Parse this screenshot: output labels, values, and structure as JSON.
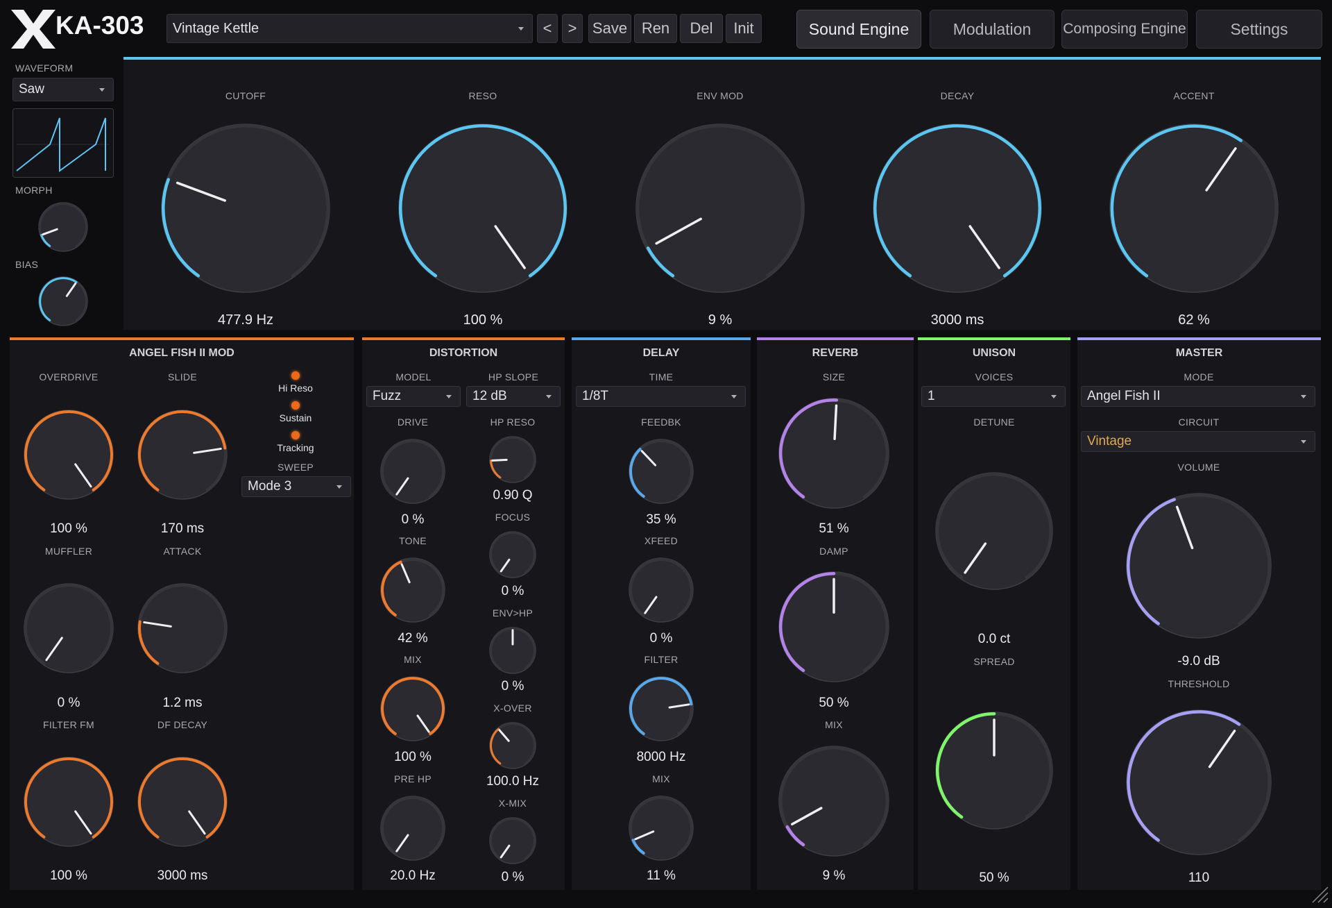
{
  "app": {
    "name": "KA-303",
    "logo_letter": "X"
  },
  "preset": {
    "name": "Vintage Kettle",
    "prev": "<",
    "next": ">",
    "save": "Save",
    "rename": "Ren",
    "delete": "Del",
    "init": "Init"
  },
  "tabs": [
    {
      "label": "Sound Engine",
      "active": true
    },
    {
      "label": "Modulation",
      "active": false
    },
    {
      "label": "Composing Engine",
      "active": false
    },
    {
      "label": "Settings",
      "active": false
    }
  ],
  "colors": {
    "blue": "#5cc6f2",
    "orange": "#ee7a2e",
    "purple": "#b483ea",
    "green": "#7ef56a",
    "lavender": "#a6a0f4",
    "delay_blue": "#5aa8ec",
    "vintage": "#e3a850"
  },
  "osc": {
    "waveform_label": "WAVEFORM",
    "waveform_value": "Saw",
    "morph_label": "MORPH",
    "morph_level": 0.12,
    "bias_label": "BIAS",
    "bias_level": 0.62
  },
  "main_knobs": [
    {
      "label": "CUTOFF",
      "value": "477.9 Hz",
      "level": 0.26
    },
    {
      "label": "RESO",
      "value": "100 %",
      "level": 1.0
    },
    {
      "label": "ENV MOD",
      "value": "9 %",
      "level": 0.09
    },
    {
      "label": "DECAY",
      "value": "3000 ms",
      "level": 1.0
    },
    {
      "label": "ACCENT",
      "value": "62 %",
      "level": 0.62
    }
  ],
  "angel": {
    "title": "ANGEL FISH II MOD",
    "knobs": [
      {
        "label": "OVERDRIVE",
        "value": "100 %",
        "level": 1.0
      },
      {
        "label": "SLIDE",
        "value": "170 ms",
        "level": 0.78
      },
      {
        "label": "MUFFLER",
        "value": "0 %",
        "level": 0.0
      },
      {
        "label": "ATTACK",
        "value": "1.2 ms",
        "level": 0.22
      },
      {
        "label": "FILTER FM",
        "value": "100 %",
        "level": 1.0
      },
      {
        "label": "DF DECAY",
        "value": "3000 ms",
        "level": 1.0
      }
    ],
    "toggles": [
      "Hi Reso",
      "Sustain",
      "Tracking"
    ],
    "sweep_label": "SWEEP",
    "sweep_value": "Mode 3"
  },
  "distortion": {
    "title": "DISTORTION",
    "model_label": "MODEL",
    "model_value": "Fuzz",
    "hpslope_label": "HP SLOPE",
    "hpslope_value": "12 dB",
    "left_knobs": [
      {
        "label": "DRIVE",
        "value": "0 %",
        "level": 0.0
      },
      {
        "label": "TONE",
        "value": "42 %",
        "level": 0.42
      },
      {
        "label": "MIX",
        "value": "100 %",
        "level": 1.0
      },
      {
        "label": "PRE HP",
        "value": "20.0 Hz",
        "level": 0.0
      }
    ],
    "right_knobs": [
      {
        "label": "HP RESO",
        "value": "0.90 Q",
        "level": 0.18
      },
      {
        "label": "FOCUS",
        "value": "0 %",
        "level": 0.0
      },
      {
        "label": "ENV>HP",
        "value": "0 %",
        "level": 0.5
      },
      {
        "label": "X-OVER",
        "value": "100.0 Hz",
        "level": 0.36
      },
      {
        "label": "X-MIX",
        "value": "0 %",
        "level": 0.0
      }
    ]
  },
  "delay": {
    "title": "DELAY",
    "time_label": "TIME",
    "time_value": "1/8T",
    "knobs": [
      {
        "label": "FEEDBK",
        "value": "35 %",
        "level": 0.35
      },
      {
        "label": "XFEED",
        "value": "0 %",
        "level": 0.0
      },
      {
        "label": "FILTER",
        "value": "8000 Hz",
        "level": 0.78
      },
      {
        "label": "MIX",
        "value": "11 %",
        "level": 0.11
      }
    ]
  },
  "reverb": {
    "title": "REVERB",
    "knobs": [
      {
        "label": "SIZE",
        "value": "51 %",
        "level": 0.51
      },
      {
        "label": "DAMP",
        "value": "50 %",
        "level": 0.5
      },
      {
        "label": "MIX",
        "value": "9 %",
        "level": 0.09
      }
    ]
  },
  "unison": {
    "title": "UNISON",
    "voices_label": "VOICES",
    "voices_value": "1",
    "detune_label": "DETUNE",
    "detune_value": "0.0 ct",
    "detune_level": 0.0,
    "spread_label": "SPREAD",
    "spread_value": "50 %",
    "spread_level": 0.5
  },
  "master": {
    "title": "MASTER",
    "mode_label": "MODE",
    "mode_value": "Angel Fish II",
    "circuit_label": "CIRCUIT",
    "circuit_value": "Vintage",
    "volume_label": "VOLUME",
    "volume_value": "-9.0 dB",
    "volume_level": 0.43,
    "threshold_label": "THRESHOLD",
    "threshold_value": "110",
    "threshold_level": 0.62
  }
}
